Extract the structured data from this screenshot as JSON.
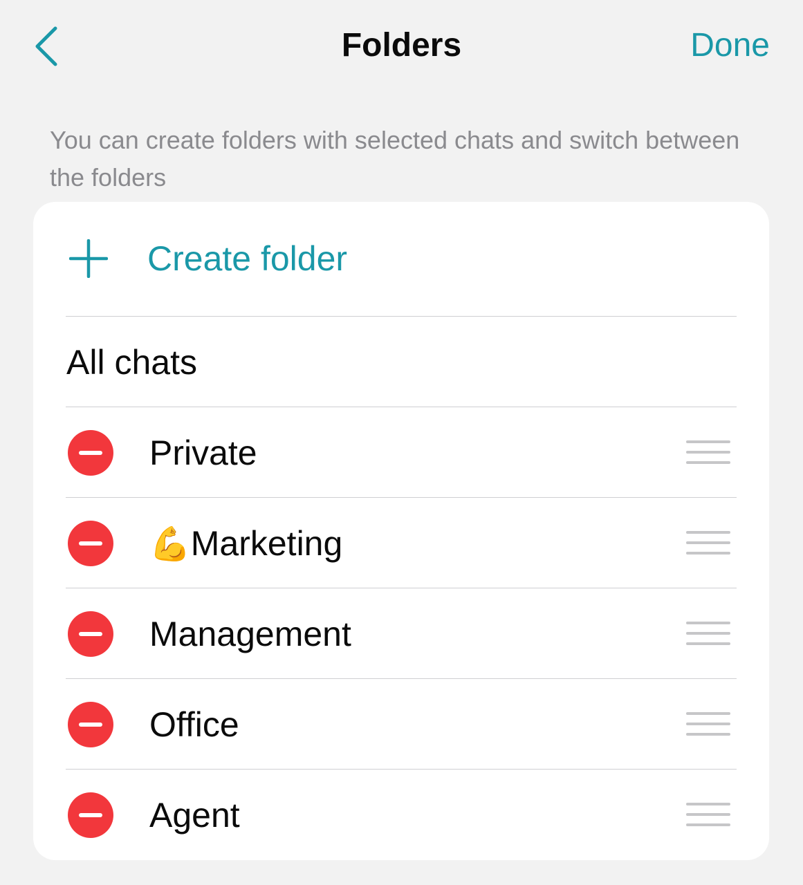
{
  "nav": {
    "title": "Folders",
    "done_label": "Done",
    "back_icon": "chevron-left-icon"
  },
  "description": "You can create folders with selected chats and switch between the folders",
  "create": {
    "label": "Create folder",
    "icon": "plus-icon"
  },
  "all_chats": {
    "label": "All chats"
  },
  "folders": [
    {
      "emoji": "",
      "name": "Private"
    },
    {
      "emoji": "💪",
      "name": "Marketing"
    },
    {
      "emoji": "",
      "name": "Management"
    },
    {
      "emoji": "",
      "name": "Office"
    },
    {
      "emoji": "",
      "name": "Agent"
    }
  ],
  "colors": {
    "accent": "#1a98a8",
    "delete": "#f2373c",
    "background": "#f2f2f2",
    "secondary_text": "#8a8a8e"
  }
}
